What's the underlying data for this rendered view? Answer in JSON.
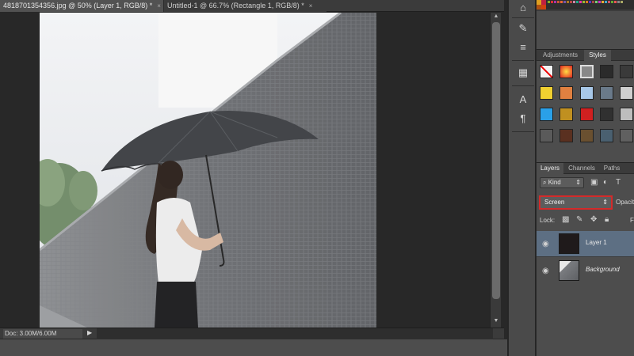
{
  "tabs": [
    {
      "label": "4818701354356.jpg @ 50% (Layer 1, RGB/8) *",
      "close": "×"
    },
    {
      "label": "Untitled-1 @ 66.7% (Rectangle 1, RGB/8) *",
      "close": "×"
    }
  ],
  "status": {
    "doc_size": "Doc: 3.00M/6.00M",
    "arrow": "▶"
  },
  "panel_tabs_top": [
    {
      "label": "Adjustments"
    },
    {
      "label": "Styles"
    }
  ],
  "layers_panel": {
    "tabs": [
      {
        "label": "Layers"
      },
      {
        "label": "Channels"
      },
      {
        "label": "Paths"
      }
    ],
    "filter_kind": "Kind",
    "filter_arrow": "⇕",
    "blend_mode": "Screen",
    "blend_arrow": "⇕",
    "opacity_label": "Opacit",
    "lock_label": "Lock:",
    "fill_label": "F",
    "layers": [
      {
        "name": "Layer 1",
        "selected": true
      },
      {
        "name": "Background",
        "selected": false
      }
    ]
  },
  "colors": {
    "accent_red": "#d42a2a",
    "selected_layer": "#5d6f83"
  },
  "icons": {
    "tools": [
      "brush-icon",
      "sliders-icon",
      "histogram-icon",
      "type-icon",
      "paragraph-icon"
    ]
  }
}
